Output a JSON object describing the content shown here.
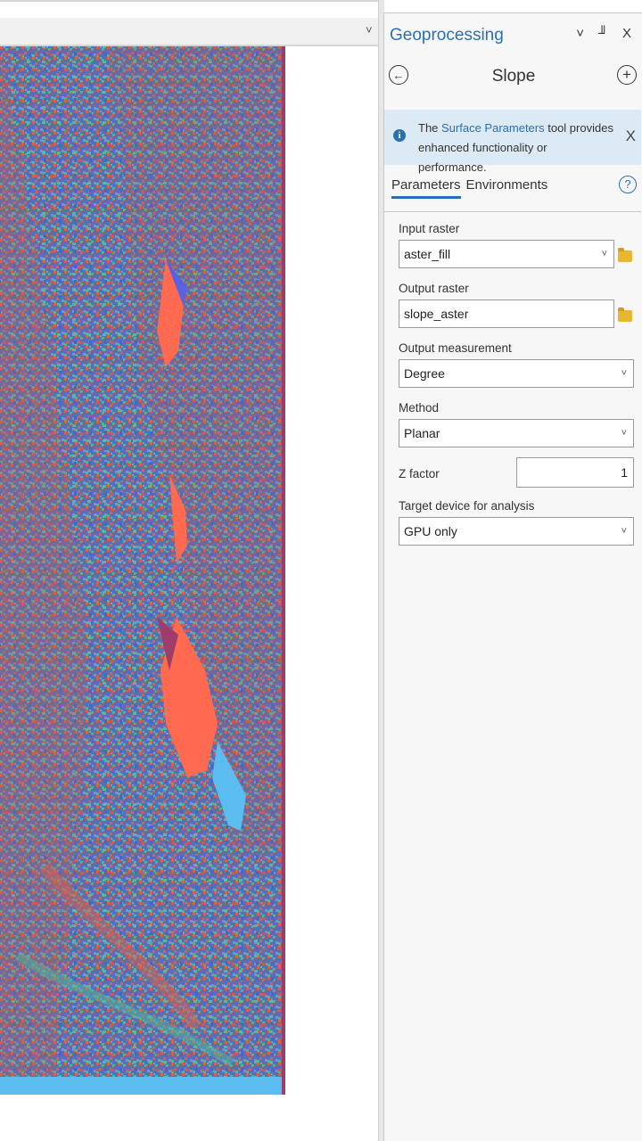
{
  "map": {
    "chevron": "˅"
  },
  "geoprocessing": {
    "title": "Geoprocessing",
    "window_buttons": [
      "˅",
      "╜",
      "X"
    ],
    "tool_name": "Slope",
    "info_banner": {
      "text_before": "The ",
      "link": "Surface Parameters",
      "text_after": " tool provides enhanced functionality or performance.",
      "close": "X"
    },
    "tabs": [
      "Parameters",
      "Environments"
    ],
    "help": "?",
    "params": {
      "input_raster_label": "Input raster",
      "input_raster_value": "aster_fill",
      "output_raster_label": "Output raster",
      "output_raster_value": "slope_aster",
      "output_measurement_label": "Output measurement",
      "output_measurement_value": "Degree",
      "method_label": "Method",
      "method_value": "Planar",
      "z_factor_label": "Z factor",
      "z_factor_value": "1",
      "target_device_label": "Target device for analysis",
      "target_device_value": "GPU only"
    }
  },
  "colors": {
    "accent": "#2a6fb5",
    "raster_red": "#e0604e",
    "raster_blue": "#4e6fc0",
    "raster_teal": "#50b8a0",
    "raster_cyan": "#5bbcf0"
  }
}
